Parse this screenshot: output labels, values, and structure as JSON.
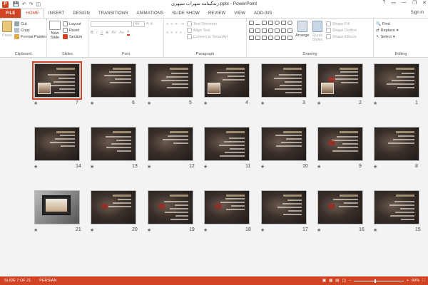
{
  "window": {
    "title": "زندگینامه سهراب سپهری.pptx - PowerPoint",
    "app_icon": "P",
    "controls": [
      "?",
      "▭",
      "—",
      "❐",
      "✕"
    ]
  },
  "tabs": [
    {
      "label": "FILE",
      "file": true
    },
    {
      "label": "HOME",
      "active": true
    },
    {
      "label": "INSERT"
    },
    {
      "label": "DESIGN"
    },
    {
      "label": "TRANSITIONS"
    },
    {
      "label": "ANIMATIONS"
    },
    {
      "label": "SLIDE SHOW"
    },
    {
      "label": "REVIEW"
    },
    {
      "label": "VIEW"
    },
    {
      "label": "ADD-INS"
    }
  ],
  "signin": "Sign in",
  "ribbon": {
    "clipboard": {
      "paste": "Paste",
      "cut": "Cut",
      "copy": "Copy",
      "format_painter": "Format Painter",
      "label": "Clipboard"
    },
    "slides": {
      "new_slide": "New",
      "new_slide2": "Slide",
      "layout": "Layout",
      "reset": "Reset",
      "section": "Section",
      "label": "Slides"
    },
    "font": {
      "size": "44",
      "label": "Font"
    },
    "paragraph": {
      "text_direction": "Text Direction",
      "align_text": "Align Text",
      "convert_smartart": "Convert to SmartArt",
      "label": "Paragraph"
    },
    "drawing": {
      "arrange": "Arrange",
      "quick_styles": "Quick",
      "quick_styles2": "Styles",
      "shape_fill": "Shape Fill",
      "shape_outline": "Shape Outline",
      "shape_effects": "Shape Effects",
      "label": "Drawing"
    },
    "editing": {
      "find": "Find",
      "replace": "Replace",
      "select": "Select",
      "label": "Editing"
    }
  },
  "slides": [
    {
      "num": "1"
    },
    {
      "num": "2"
    },
    {
      "num": "3"
    },
    {
      "num": "4"
    },
    {
      "num": "5"
    },
    {
      "num": "6"
    },
    {
      "num": "7",
      "selected": true
    },
    {
      "num": "8"
    },
    {
      "num": "9"
    },
    {
      "num": "10"
    },
    {
      "num": "11"
    },
    {
      "num": "12"
    },
    {
      "num": "13"
    },
    {
      "num": "14"
    },
    {
      "num": "15"
    },
    {
      "num": "16"
    },
    {
      "num": "17"
    },
    {
      "num": "18"
    },
    {
      "num": "19"
    },
    {
      "num": "20"
    },
    {
      "num": "21"
    }
  ],
  "star": "★",
  "status": {
    "slide_info": "SLIDE 7 OF 21",
    "language": "PERSIAN",
    "zoom": "60%",
    "zoom_level_percent": 60
  },
  "colors": {
    "accent": "#d04423"
  }
}
